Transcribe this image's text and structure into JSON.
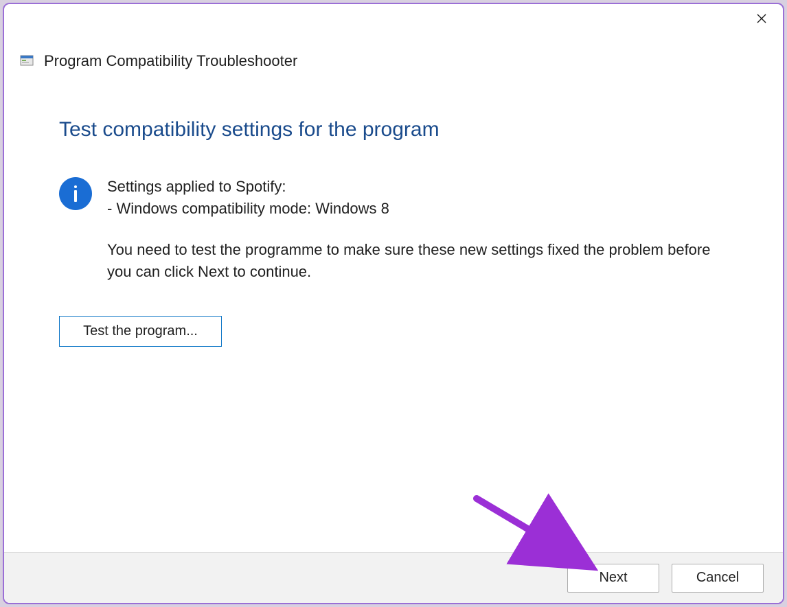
{
  "window": {
    "title": "Program Compatibility Troubleshooter"
  },
  "content": {
    "heading": "Test compatibility settings for the program",
    "settings_applied_line": "Settings applied to Spotify:",
    "compat_mode_line": "- Windows compatibility mode: Windows 8",
    "instruction": "You need to test the programme to make sure these new settings fixed the problem before you can click Next to continue.",
    "test_button_label": "Test the program..."
  },
  "footer": {
    "next_label": "Next",
    "cancel_label": "Cancel"
  },
  "icons": {
    "info": "info",
    "close": "close",
    "wizard": "wizard"
  },
  "colors": {
    "accent_border": "#9b6fd6",
    "heading_blue": "#1a4b8c",
    "button_outline": "#0f77c7",
    "arrow": "#9b2fd6"
  }
}
